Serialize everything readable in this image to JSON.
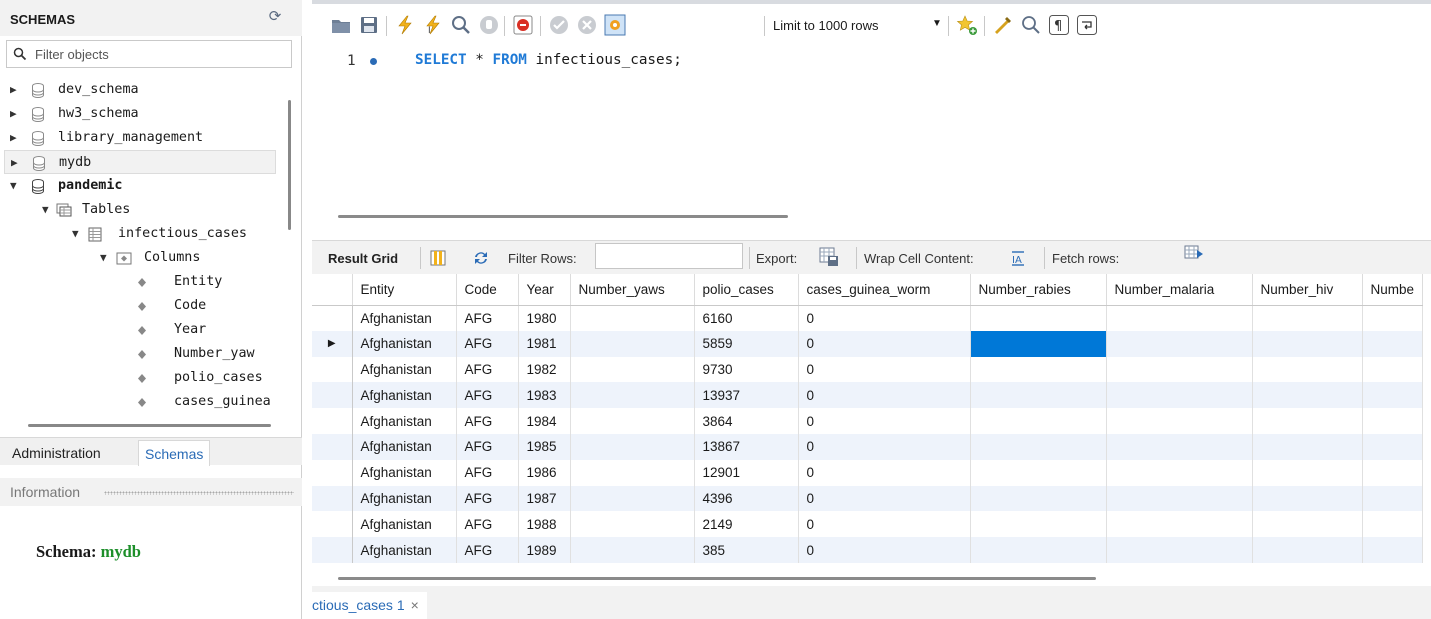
{
  "sidebar": {
    "title": "SCHEMAS",
    "filter_placeholder": "Filter objects",
    "tree": {
      "schemas": [
        "dev_schema",
        "hw3_schema",
        "library_management",
        "mydb",
        "pandemic"
      ],
      "tables_label": "Tables",
      "table": "infectious_cases",
      "columns_label": "Columns",
      "columns": [
        "Entity",
        "Code",
        "Year",
        "Number_yaw",
        "polio_cases",
        "cases_guinea"
      ]
    },
    "tabs": {
      "administration": "Administration",
      "schemas": "Schemas"
    },
    "information_label": "Information",
    "schema_info": {
      "label": "Schema:",
      "name": "mydb"
    }
  },
  "toolbar": {
    "limit_label": "Limit to 1000 rows"
  },
  "editor": {
    "line_number": "1",
    "keyword_select": "SELECT",
    "star": " * ",
    "keyword_from": "FROM",
    "rest": " infectious_cases;"
  },
  "result_toolbar": {
    "result_grid": "Result Grid",
    "filter_rows": "Filter Rows:",
    "export": "Export:",
    "wrap": "Wrap Cell Content:",
    "fetch": "Fetch rows:"
  },
  "grid": {
    "columns": [
      "Entity",
      "Code",
      "Year",
      "Number_yaws",
      "polio_cases",
      "cases_guinea_worm",
      "Number_rabies",
      "Number_malaria",
      "Number_hiv",
      "Numbe"
    ],
    "rows": [
      [
        "Afghanistan",
        "AFG",
        "1980",
        "",
        "6160",
        "0",
        "",
        "",
        "",
        ""
      ],
      [
        "Afghanistan",
        "AFG",
        "1981",
        "",
        "5859",
        "0",
        "",
        "",
        "",
        ""
      ],
      [
        "Afghanistan",
        "AFG",
        "1982",
        "",
        "9730",
        "0",
        "",
        "",
        "",
        ""
      ],
      [
        "Afghanistan",
        "AFG",
        "1983",
        "",
        "13937",
        "0",
        "",
        "",
        "",
        ""
      ],
      [
        "Afghanistan",
        "AFG",
        "1984",
        "",
        "3864",
        "0",
        "",
        "",
        "",
        ""
      ],
      [
        "Afghanistan",
        "AFG",
        "1985",
        "",
        "13867",
        "0",
        "",
        "",
        "",
        ""
      ],
      [
        "Afghanistan",
        "AFG",
        "1986",
        "",
        "12901",
        "0",
        "",
        "",
        "",
        ""
      ],
      [
        "Afghanistan",
        "AFG",
        "1987",
        "",
        "4396",
        "0",
        "",
        "",
        "",
        ""
      ],
      [
        "Afghanistan",
        "AFG",
        "1988",
        "",
        "2149",
        "0",
        "",
        "",
        "",
        ""
      ],
      [
        "Afghanistan",
        "AFG",
        "1989",
        "",
        "385",
        "0",
        "",
        "",
        "",
        ""
      ]
    ],
    "current_row_marker": "▶"
  },
  "output_tab": {
    "label": "ctious_cases 1",
    "close": "×"
  },
  "colors": {
    "accent": "#1f7ad6",
    "selection": "#0078d7",
    "schema_name": "#1d8f2a",
    "row_stripe": "#eef3fb"
  }
}
